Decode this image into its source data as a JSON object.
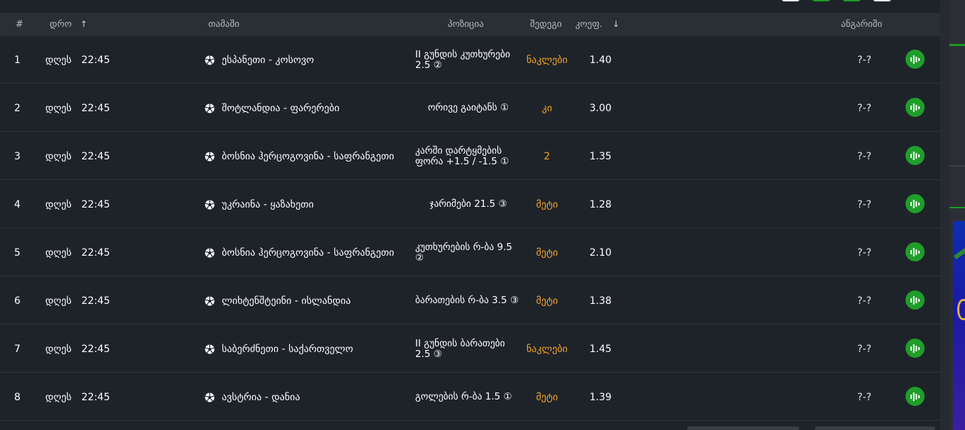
{
  "header": {
    "col_num": "#",
    "col_time": "დრო",
    "col_time_sort": "↑",
    "col_game": "თამაში",
    "col_position": "პოზიცია",
    "col_result": "შედეგი",
    "col_odds": "კოეფ.",
    "col_odds_sort": "↓",
    "col_account": "ანგარიში"
  },
  "rows": [
    {
      "num": "1",
      "day": "დღეს",
      "time": "22:45",
      "game": "ესპანეთი - კოსოვო",
      "position": "II გუნდის კუთხურები 2.5 ②",
      "result": "ნაკლები",
      "odds": "1.40",
      "account": "?-?"
    },
    {
      "num": "2",
      "day": "დღეს",
      "time": "22:45",
      "game": "შოტლანდია - ფარერები",
      "position": "ორივე გაიტანს ①",
      "result": "კი",
      "odds": "3.00",
      "account": "?-?"
    },
    {
      "num": "3",
      "day": "დღეს",
      "time": "22:45",
      "game": "ბოსნია ჰერცოგოვინა - საფრანგეთი",
      "position": "კარში დარტყმების ფორა +1.5 / -1.5 ①",
      "result": "2",
      "odds": "1.35",
      "account": "?-?"
    },
    {
      "num": "4",
      "day": "დღეს",
      "time": "22:45",
      "game": "უკრაინა - ყაზახეთი",
      "position": "ჯარიმები 21.5 ③",
      "result": "მეტი",
      "odds": "1.28",
      "account": "?-?"
    },
    {
      "num": "5",
      "day": "დღეს",
      "time": "22:45",
      "game": "ბოსნია ჰერცოგოვინა - საფრანგეთი",
      "position": "კუთხურების რ-ბა 9.5 ②",
      "result": "მეტი",
      "odds": "2.10",
      "account": "?-?"
    },
    {
      "num": "6",
      "day": "დღეს",
      "time": "22:45",
      "game": "ლიხტენშტეინი - ისლანდია",
      "position": "ბარათების რ-ბა 3.5 ③",
      "result": "მეტი",
      "odds": "1.38",
      "account": "?-?"
    },
    {
      "num": "7",
      "day": "დღეს",
      "time": "22:45",
      "game": "საბერძნეთი - საქართველო",
      "position": "II გუნდის ბარათები 2.5 ③",
      "result": "ნაკლები",
      "odds": "1.45",
      "account": "?-?"
    },
    {
      "num": "8",
      "day": "დღეს",
      "time": "22:45",
      "game": "ავსტრია - დანია",
      "position": "გოლების რ-ბა 1.5 ①",
      "result": "მეტი",
      "odds": "1.39",
      "account": "?-?"
    }
  ],
  "icons": {
    "game_icon": "soccer-ball-icon",
    "stats_icon": "bar-chart-icon"
  },
  "colors": {
    "accent_green": "#1f9e2a",
    "result_orange": "#f5a623",
    "background": "#1e232a",
    "header_bg": "#2a2f36"
  }
}
